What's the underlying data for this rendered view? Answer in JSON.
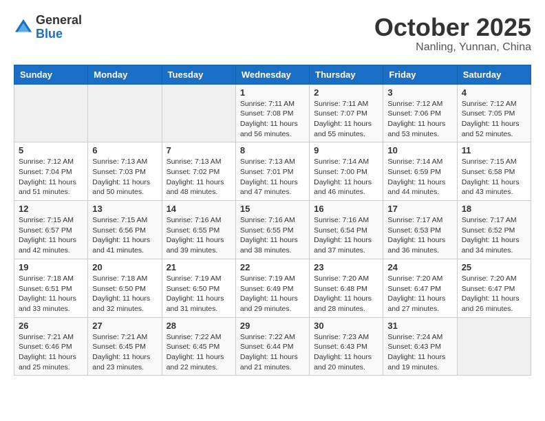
{
  "header": {
    "logo_general": "General",
    "logo_blue": "Blue",
    "month": "October 2025",
    "location": "Nanling, Yunnan, China"
  },
  "weekdays": [
    "Sunday",
    "Monday",
    "Tuesday",
    "Wednesday",
    "Thursday",
    "Friday",
    "Saturday"
  ],
  "weeks": [
    [
      {
        "day": "",
        "sunrise": "",
        "sunset": "",
        "daylight": ""
      },
      {
        "day": "",
        "sunrise": "",
        "sunset": "",
        "daylight": ""
      },
      {
        "day": "",
        "sunrise": "",
        "sunset": "",
        "daylight": ""
      },
      {
        "day": "1",
        "sunrise": "Sunrise: 7:11 AM",
        "sunset": "Sunset: 7:08 PM",
        "daylight": "Daylight: 11 hours and 56 minutes."
      },
      {
        "day": "2",
        "sunrise": "Sunrise: 7:11 AM",
        "sunset": "Sunset: 7:07 PM",
        "daylight": "Daylight: 11 hours and 55 minutes."
      },
      {
        "day": "3",
        "sunrise": "Sunrise: 7:12 AM",
        "sunset": "Sunset: 7:06 PM",
        "daylight": "Daylight: 11 hours and 53 minutes."
      },
      {
        "day": "4",
        "sunrise": "Sunrise: 7:12 AM",
        "sunset": "Sunset: 7:05 PM",
        "daylight": "Daylight: 11 hours and 52 minutes."
      }
    ],
    [
      {
        "day": "5",
        "sunrise": "Sunrise: 7:12 AM",
        "sunset": "Sunset: 7:04 PM",
        "daylight": "Daylight: 11 hours and 51 minutes."
      },
      {
        "day": "6",
        "sunrise": "Sunrise: 7:13 AM",
        "sunset": "Sunset: 7:03 PM",
        "daylight": "Daylight: 11 hours and 50 minutes."
      },
      {
        "day": "7",
        "sunrise": "Sunrise: 7:13 AM",
        "sunset": "Sunset: 7:02 PM",
        "daylight": "Daylight: 11 hours and 48 minutes."
      },
      {
        "day": "8",
        "sunrise": "Sunrise: 7:13 AM",
        "sunset": "Sunset: 7:01 PM",
        "daylight": "Daylight: 11 hours and 47 minutes."
      },
      {
        "day": "9",
        "sunrise": "Sunrise: 7:14 AM",
        "sunset": "Sunset: 7:00 PM",
        "daylight": "Daylight: 11 hours and 46 minutes."
      },
      {
        "day": "10",
        "sunrise": "Sunrise: 7:14 AM",
        "sunset": "Sunset: 6:59 PM",
        "daylight": "Daylight: 11 hours and 44 minutes."
      },
      {
        "day": "11",
        "sunrise": "Sunrise: 7:15 AM",
        "sunset": "Sunset: 6:58 PM",
        "daylight": "Daylight: 11 hours and 43 minutes."
      }
    ],
    [
      {
        "day": "12",
        "sunrise": "Sunrise: 7:15 AM",
        "sunset": "Sunset: 6:57 PM",
        "daylight": "Daylight: 11 hours and 42 minutes."
      },
      {
        "day": "13",
        "sunrise": "Sunrise: 7:15 AM",
        "sunset": "Sunset: 6:56 PM",
        "daylight": "Daylight: 11 hours and 41 minutes."
      },
      {
        "day": "14",
        "sunrise": "Sunrise: 7:16 AM",
        "sunset": "Sunset: 6:55 PM",
        "daylight": "Daylight: 11 hours and 39 minutes."
      },
      {
        "day": "15",
        "sunrise": "Sunrise: 7:16 AM",
        "sunset": "Sunset: 6:55 PM",
        "daylight": "Daylight: 11 hours and 38 minutes."
      },
      {
        "day": "16",
        "sunrise": "Sunrise: 7:16 AM",
        "sunset": "Sunset: 6:54 PM",
        "daylight": "Daylight: 11 hours and 37 minutes."
      },
      {
        "day": "17",
        "sunrise": "Sunrise: 7:17 AM",
        "sunset": "Sunset: 6:53 PM",
        "daylight": "Daylight: 11 hours and 36 minutes."
      },
      {
        "day": "18",
        "sunrise": "Sunrise: 7:17 AM",
        "sunset": "Sunset: 6:52 PM",
        "daylight": "Daylight: 11 hours and 34 minutes."
      }
    ],
    [
      {
        "day": "19",
        "sunrise": "Sunrise: 7:18 AM",
        "sunset": "Sunset: 6:51 PM",
        "daylight": "Daylight: 11 hours and 33 minutes."
      },
      {
        "day": "20",
        "sunrise": "Sunrise: 7:18 AM",
        "sunset": "Sunset: 6:50 PM",
        "daylight": "Daylight: 11 hours and 32 minutes."
      },
      {
        "day": "21",
        "sunrise": "Sunrise: 7:19 AM",
        "sunset": "Sunset: 6:50 PM",
        "daylight": "Daylight: 11 hours and 31 minutes."
      },
      {
        "day": "22",
        "sunrise": "Sunrise: 7:19 AM",
        "sunset": "Sunset: 6:49 PM",
        "daylight": "Daylight: 11 hours and 29 minutes."
      },
      {
        "day": "23",
        "sunrise": "Sunrise: 7:20 AM",
        "sunset": "Sunset: 6:48 PM",
        "daylight": "Daylight: 11 hours and 28 minutes."
      },
      {
        "day": "24",
        "sunrise": "Sunrise: 7:20 AM",
        "sunset": "Sunset: 6:47 PM",
        "daylight": "Daylight: 11 hours and 27 minutes."
      },
      {
        "day": "25",
        "sunrise": "Sunrise: 7:20 AM",
        "sunset": "Sunset: 6:47 PM",
        "daylight": "Daylight: 11 hours and 26 minutes."
      }
    ],
    [
      {
        "day": "26",
        "sunrise": "Sunrise: 7:21 AM",
        "sunset": "Sunset: 6:46 PM",
        "daylight": "Daylight: 11 hours and 25 minutes."
      },
      {
        "day": "27",
        "sunrise": "Sunrise: 7:21 AM",
        "sunset": "Sunset: 6:45 PM",
        "daylight": "Daylight: 11 hours and 23 minutes."
      },
      {
        "day": "28",
        "sunrise": "Sunrise: 7:22 AM",
        "sunset": "Sunset: 6:45 PM",
        "daylight": "Daylight: 11 hours and 22 minutes."
      },
      {
        "day": "29",
        "sunrise": "Sunrise: 7:22 AM",
        "sunset": "Sunset: 6:44 PM",
        "daylight": "Daylight: 11 hours and 21 minutes."
      },
      {
        "day": "30",
        "sunrise": "Sunrise: 7:23 AM",
        "sunset": "Sunset: 6:43 PM",
        "daylight": "Daylight: 11 hours and 20 minutes."
      },
      {
        "day": "31",
        "sunrise": "Sunrise: 7:24 AM",
        "sunset": "Sunset: 6:43 PM",
        "daylight": "Daylight: 11 hours and 19 minutes."
      },
      {
        "day": "",
        "sunrise": "",
        "sunset": "",
        "daylight": ""
      }
    ]
  ]
}
